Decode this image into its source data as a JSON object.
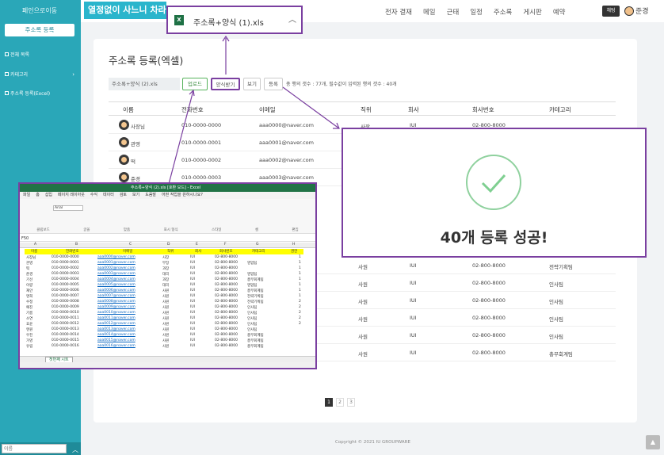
{
  "sidebar": {
    "title": "페인으로이동",
    "register_button": "주소록 등록",
    "items": [
      {
        "label": "전체 목록"
      },
      {
        "label": "카테고리"
      },
      {
        "label": "주소록 등록(Excel)"
      }
    ],
    "search_placeholder": "이름"
  },
  "banner": {
    "text": "열정없이 사느니 차라"
  },
  "topnav": {
    "items": [
      "전자 결재",
      "메일",
      "근태",
      "일정",
      "주소록",
      "게시판",
      "예약"
    ],
    "badge": "채팅",
    "user": "준경"
  },
  "page": {
    "title": "주소록 등록(엑셀)",
    "file_name": "주소록+양식 (2).xls",
    "upload_label": "업로드",
    "template_label": "양식받기",
    "view_label": "보기",
    "register_label": "등록",
    "status": "총 행의 갯수 : 77개, 필수값이 입력된 행의 갯수 : 40개"
  },
  "table": {
    "headers": [
      "이름",
      "전화번호",
      "이메일",
      "직위",
      "회사",
      "회사번호",
      "카테고리"
    ],
    "rows": [
      {
        "name": "사장님",
        "phone": "010-0000-0000",
        "email": "aaa0000@naver.com",
        "position": "사장",
        "company": "IUI",
        "tel": "02-800-8000",
        "category": ""
      },
      {
        "name": "관영",
        "phone": "010-0000-0001",
        "email": "aaa0001@naver.com",
        "position": "",
        "company": "",
        "tel": "",
        "category": ""
      },
      {
        "name": "떡",
        "phone": "010-0000-0002",
        "email": "aaa0002@naver.com",
        "position": "",
        "company": "",
        "tel": "",
        "category": ""
      },
      {
        "name": "준경",
        "phone": "010-0000-0003",
        "email": "aaa0003@naver.com",
        "position": "",
        "company": "",
        "tel": "",
        "category": ""
      }
    ],
    "lower_rows": [
      {
        "position": "사원",
        "company": "IUI",
        "tel": "02-800-8000",
        "category": "전략기획팀"
      },
      {
        "position": "사원",
        "company": "IUI",
        "tel": "02-800-8000",
        "category": "인사팀"
      },
      {
        "position": "사원",
        "company": "IUI",
        "tel": "02-800-8000",
        "category": "인사팀"
      },
      {
        "position": "사원",
        "company": "IUI",
        "tel": "02-800-8000",
        "category": "인사팀"
      },
      {
        "position": "사원",
        "company": "IUI",
        "tel": "02-800-8000",
        "category": "인사팀"
      },
      {
        "position": "사원",
        "company": "IUI",
        "tel": "02-800-8000",
        "category": "총무회계팀"
      }
    ]
  },
  "download": {
    "file_name": "주소록+양식 (1).xls"
  },
  "success": {
    "message": "40개 등록 성공!"
  },
  "pager": {
    "pages": [
      "1",
      "2",
      "3"
    ]
  },
  "footer": {
    "copyright": "Copyright © 2021 IU GROUPWARE"
  },
  "excel": {
    "title": "주소록+양식 (2).xls [호환 모드] - Excel",
    "menu": [
      "파일",
      "홈",
      "삽입",
      "페이지 레이아웃",
      "수식",
      "데이터",
      "검토",
      "보기",
      "도움말",
      "어떤 작업을 원하시나요?"
    ],
    "font": "Arial",
    "cell_ref": "F50",
    "groups": [
      "클립보드",
      "글꼴",
      "맞춤",
      "표시 형식",
      "스타일",
      "셀",
      "편집"
    ],
    "columns": [
      "A",
      "B",
      "C",
      "D",
      "E",
      "F",
      "G",
      "H"
    ],
    "headers": [
      "이름",
      "전화번호",
      "이메일",
      "직위",
      "회사",
      "회사번호",
      "카테고리",
      "권한"
    ],
    "rows": [
      [
        "사장님",
        "010-0000-0000",
        "aaa0000@naver.com",
        "사장",
        "IUI",
        "02-800-8000",
        "",
        "1"
      ],
      [
        "관영",
        "010-0000-0001",
        "aaa0001@naver.com",
        "부장",
        "IUI",
        "02-800-8000",
        "영업팀",
        "1"
      ],
      [
        "떡",
        "010-0000-0002",
        "aaa0002@naver.com",
        "과장",
        "IUI",
        "02-800-8000",
        "",
        "1"
      ],
      [
        "준경",
        "010-0000-0003",
        "aaa0003@naver.com",
        "대리",
        "IUI",
        "02-800-8000",
        "영업팀",
        "1"
      ],
      [
        "기선",
        "010-0000-0004",
        "aaa0004@naver.com",
        "과장",
        "IUI",
        "02-800-8000",
        "총무회계팀",
        "1"
      ],
      [
        "이량",
        "010-0000-0005",
        "aaa0005@naver.com",
        "대리",
        "IUI",
        "02-800-8000",
        "영업팀",
        "1"
      ],
      [
        "재안",
        "010-0000-0006",
        "aaa0006@naver.com",
        "사원",
        "IUI",
        "02-800-8000",
        "총무회계팀",
        "1"
      ],
      [
        "명희",
        "010-0000-0007",
        "aaa0007@naver.com",
        "사원",
        "IUI",
        "02-800-8000",
        "전략기획팀",
        "1"
      ],
      [
        "수정",
        "010-0000-0008",
        "aaa0008@naver.com",
        "사원",
        "IUI",
        "02-800-8000",
        "전략기획팀",
        "2"
      ],
      [
        "예진",
        "010-0000-0009",
        "aaa0009@naver.com",
        "사원",
        "IUI",
        "02-800-8000",
        "인사팀",
        "2"
      ],
      [
        "기름",
        "010-0000-0010",
        "aaa0010@naver.com",
        "사원",
        "IUI",
        "02-800-8000",
        "인사팀",
        "2"
      ],
      [
        "소연",
        "010-0000-0011",
        "aaa0011@naver.com",
        "사원",
        "IUI",
        "02-800-8000",
        "인사팀",
        "2"
      ],
      [
        "효윤",
        "010-0000-0012",
        "aaa0012@naver.com",
        "사원",
        "IUI",
        "02-800-8000",
        "인사팀",
        "2"
      ],
      [
        "엔원",
        "010-0000-0013",
        "aaa0013@naver.com",
        "사원",
        "IUI",
        "02-800-8000",
        "인사팀",
        ""
      ],
      [
        "우진",
        "010-0000-0014",
        "aaa0014@naver.com",
        "사원",
        "IUI",
        "02-800-8000",
        "총무회계팀",
        ""
      ],
      [
        "가영",
        "010-0000-0015",
        "aaa0015@naver.com",
        "사원",
        "IUI",
        "02-800-8000",
        "총무회계팀",
        ""
      ],
      [
        "유림",
        "010-0000-0016",
        "aaa0016@naver.com",
        "사원",
        "IUI",
        "02-800-8000",
        "총무회계팀",
        ""
      ]
    ],
    "sheet_tab": "첫번째 시트"
  }
}
